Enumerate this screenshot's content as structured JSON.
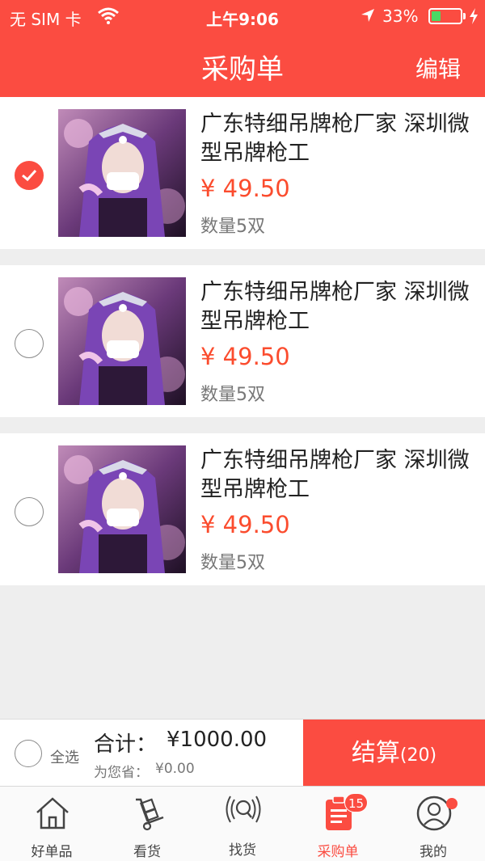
{
  "status": {
    "carrier": "无 SIM 卡",
    "time": "上午9:06",
    "battery": "33%",
    "battery_level": 0.33
  },
  "nav": {
    "title": "采购单",
    "edit": "编辑"
  },
  "items": [
    {
      "name": "广东特细吊牌枪厂家 深圳微型吊牌枪工",
      "price": "¥ 49.50",
      "qty": "数量5双",
      "checked": true
    },
    {
      "name": "广东特细吊牌枪厂家 深圳微型吊牌枪工",
      "price": "¥ 49.50",
      "qty": "数量5双",
      "checked": false
    },
    {
      "name": "广东特细吊牌枪厂家 深圳微型吊牌枪工",
      "price": "¥ 49.50",
      "qty": "数量5双",
      "checked": false
    }
  ],
  "footer": {
    "select_all": "全选",
    "total_label": "合计：",
    "total_value": "¥1000.00",
    "save_label": "为您省：",
    "save_value": "¥0.00",
    "checkout_label": "结算",
    "checkout_count": "(20)"
  },
  "tabs": [
    {
      "label": "好单品",
      "icon": "home-icon"
    },
    {
      "label": "看货",
      "icon": "hand-truck-icon"
    },
    {
      "label": "找货",
      "icon": "radar-search-icon"
    },
    {
      "label": "采购单",
      "icon": "clipboard-list-icon",
      "badge": "15"
    },
    {
      "label": "我的",
      "icon": "user-profile-icon"
    }
  ],
  "colors": {
    "accent": "#fb4c41",
    "price": "#fb4c2e"
  }
}
